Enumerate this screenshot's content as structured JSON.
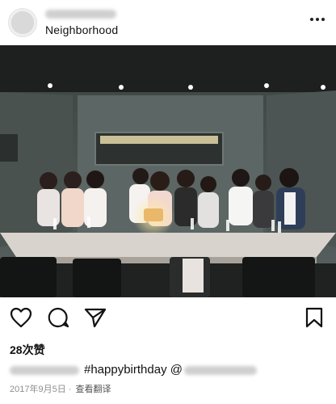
{
  "header": {
    "location": "Neighborhood"
  },
  "post": {
    "likes": "28次赞",
    "caption_hashtag": "#happybirthday",
    "caption_at": "@",
    "date": "2017年9月5日",
    "separator": " · ",
    "translate": "查看翻译"
  },
  "icons": [
    "more-icon",
    "heart-icon",
    "comment-icon",
    "share-icon",
    "bookmark-icon"
  ]
}
